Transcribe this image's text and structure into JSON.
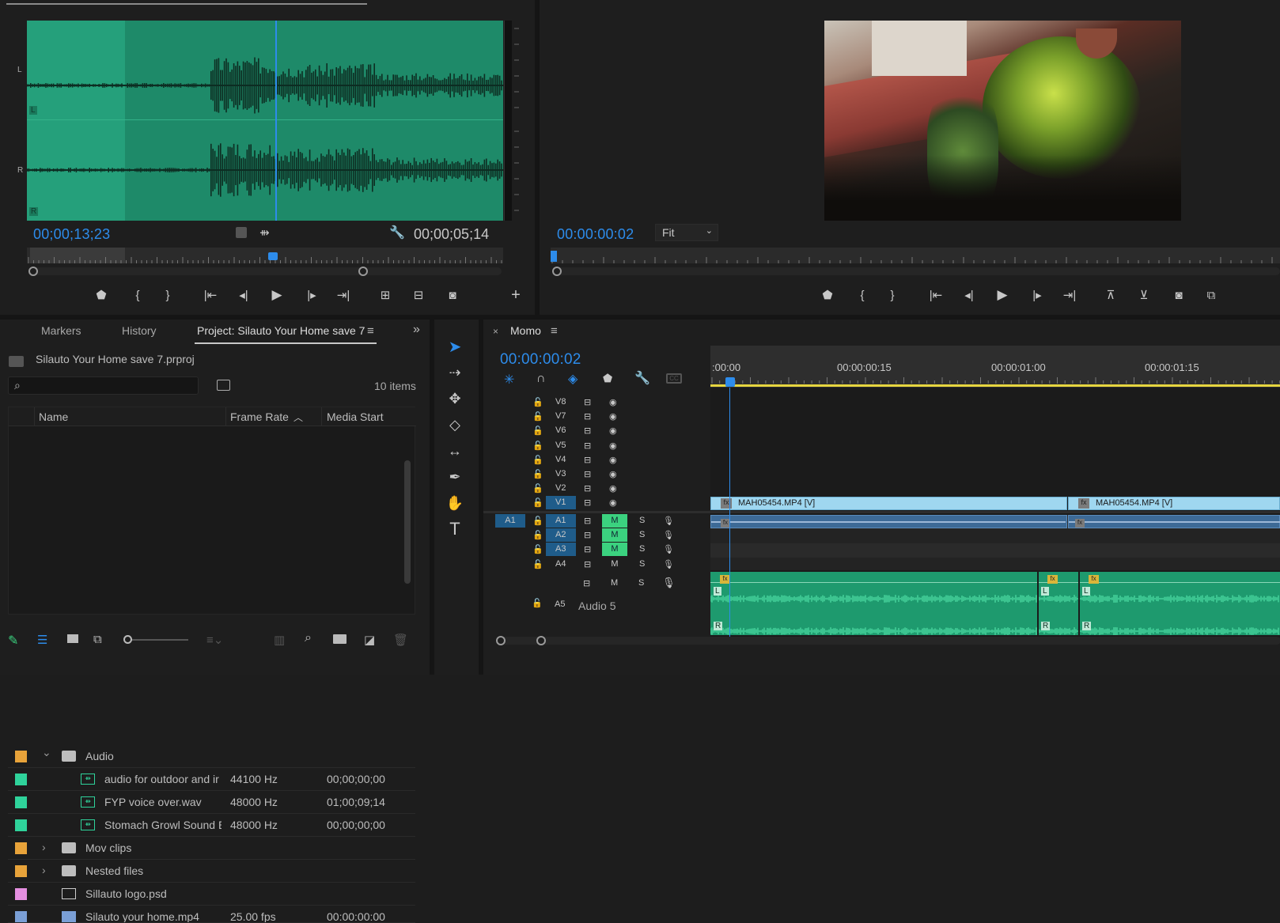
{
  "source_monitor": {
    "channel_left": "L",
    "channel_right": "R",
    "timecode_current": "00;00;13;23",
    "timecode_duration": "00;00;05;14"
  },
  "program_monitor": {
    "timecode_current": "00:00:00:02",
    "zoom_select": "Fit"
  },
  "project_panel": {
    "tabs": [
      "Markers",
      "History",
      "Project: Silauto Your Home save 7"
    ],
    "project_file": "Silauto Your Home save 7.prproj",
    "item_count": "10 items",
    "columns": [
      "Name",
      "Frame Rate",
      "Media Start"
    ],
    "rows": [
      {
        "name": "Audio",
        "rate": "",
        "start": "",
        "color": "#e8a33a",
        "type": "folder",
        "expanded": true,
        "indent": 0
      },
      {
        "name": "audio for outdoor and ir",
        "rate": "44100 Hz",
        "start": "00;00;00;00",
        "color": "#2fd39b",
        "type": "audio",
        "indent": 1
      },
      {
        "name": "FYP voice over.wav",
        "rate": "48000 Hz",
        "start": "01;00;09;14",
        "color": "#2fd39b",
        "type": "audio",
        "indent": 1
      },
      {
        "name": "Stomach Growl Sound E",
        "rate": "48000 Hz",
        "start": "00;00;00;00",
        "color": "#2fd39b",
        "type": "audio",
        "indent": 1
      },
      {
        "name": "Mov clips",
        "rate": "",
        "start": "",
        "color": "#e8a33a",
        "type": "folder",
        "expanded": false,
        "indent": 0
      },
      {
        "name": "Nested files",
        "rate": "",
        "start": "",
        "color": "#e8a33a",
        "type": "folder",
        "expanded": false,
        "indent": 0
      },
      {
        "name": "Sillauto logo.psd",
        "rate": "",
        "start": "",
        "color": "#e58fe0",
        "type": "image",
        "indent": 0
      },
      {
        "name": "Silauto your home.mp4",
        "rate": "25.00 fps",
        "start": "00:00:00:00",
        "color": "#7a9fd6",
        "type": "video",
        "indent": 0
      }
    ]
  },
  "timeline": {
    "sequence_name": "Momo",
    "timecode": "00:00:00:02",
    "ruler": [
      ":00:00",
      "00:00:00:15",
      "00:00:01:00",
      "00:00:01:15"
    ],
    "video_tracks": [
      "V8",
      "V7",
      "V6",
      "V5",
      "V4",
      "V3",
      "V2",
      "V1"
    ],
    "audio_tracks": [
      "A1",
      "A2",
      "A3",
      "A4"
    ],
    "source_patch": "A1",
    "track_m": "M",
    "track_s": "S",
    "a5_label": "A5",
    "a5_name": "Audio 5",
    "clip_v1a": "MAH05454.MP4 [V]",
    "clip_v1b": "MAH05454.MP4 [V]",
    "clip_fx": "fx",
    "ch_l": "L",
    "ch_r": "R"
  },
  "colors": {
    "accent": "#2d8ceb",
    "waveform_bg": "#1f8a6a",
    "video_clip": "#9fd7f0",
    "audio_clip": "#1e9a6e",
    "mute_green": "#3bd27f"
  }
}
